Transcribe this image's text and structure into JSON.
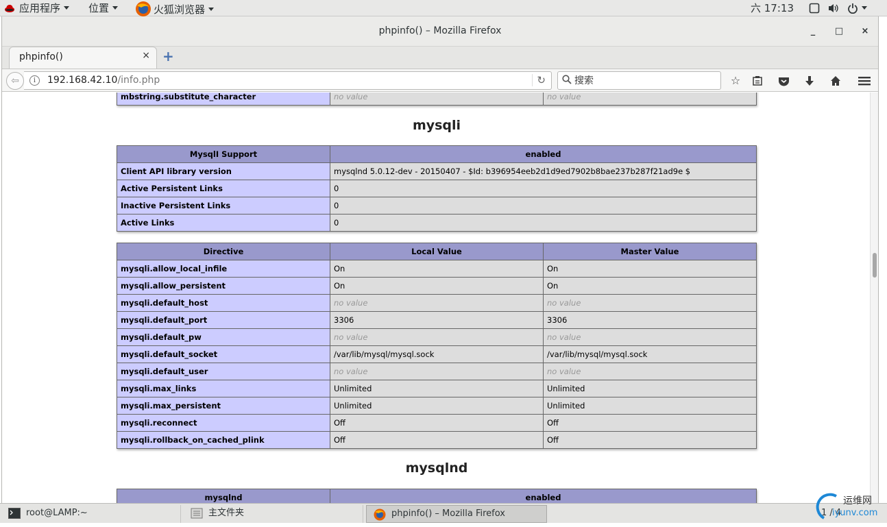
{
  "panel": {
    "apps_label": "应用程序",
    "places_label": "位置",
    "browser_label": "火狐浏览器",
    "clock": "六 17:13"
  },
  "window": {
    "title": "phpinfo() – Mozilla Firefox",
    "minimize": "_",
    "maximize": "□",
    "close": "×"
  },
  "tab": {
    "label": "phpinfo()",
    "close": "×",
    "new_tab": "+"
  },
  "nav": {
    "url_host": "192.168.42.10",
    "url_path": "/info.php",
    "search_placeholder": "搜索"
  },
  "content": {
    "top_row": {
      "key": "mbstring.substitute_character",
      "local": "no value",
      "master": "no value"
    },
    "mysqli_heading": "mysqli",
    "mysqli_support": {
      "header_key": "MysqlI Support",
      "header_value": "enabled",
      "rows": [
        {
          "key": "Client API library version",
          "value": "mysqlnd 5.0.12-dev - 20150407 - $Id: b396954eeb2d1d9ed7902b8bae237b287f21ad9e $"
        },
        {
          "key": "Active Persistent Links",
          "value": "0"
        },
        {
          "key": "Inactive Persistent Links",
          "value": "0"
        },
        {
          "key": "Active Links",
          "value": "0"
        }
      ]
    },
    "directives": {
      "headers": [
        "Directive",
        "Local Value",
        "Master Value"
      ],
      "rows": [
        {
          "key": "mysqli.allow_local_infile",
          "local": "On",
          "master": "On"
        },
        {
          "key": "mysqli.allow_persistent",
          "local": "On",
          "master": "On"
        },
        {
          "key": "mysqli.default_host",
          "local": "no value",
          "master": "no value"
        },
        {
          "key": "mysqli.default_port",
          "local": "3306",
          "master": "3306"
        },
        {
          "key": "mysqli.default_pw",
          "local": "no value",
          "master": "no value"
        },
        {
          "key": "mysqli.default_socket",
          "local": "/var/lib/mysql/mysql.sock",
          "master": "/var/lib/mysql/mysql.sock"
        },
        {
          "key": "mysqli.default_user",
          "local": "no value",
          "master": "no value"
        },
        {
          "key": "mysqli.max_links",
          "local": "Unlimited",
          "master": "Unlimited"
        },
        {
          "key": "mysqli.max_persistent",
          "local": "Unlimited",
          "master": "Unlimited"
        },
        {
          "key": "mysqli.reconnect",
          "local": "Off",
          "master": "Off"
        },
        {
          "key": "mysqli.rollback_on_cached_plink",
          "local": "Off",
          "master": "Off"
        }
      ]
    },
    "mysqlnd_heading": "mysqlnd",
    "mysqlnd_header": {
      "key": "mysqlnd",
      "value": "enabled"
    }
  },
  "taskbar": {
    "tasks": [
      {
        "label": "root@LAMP:~"
      },
      {
        "label": "主文件夹"
      },
      {
        "label": "phpinfo() – Mozilla Firefox"
      }
    ],
    "page_indicator": "1 / 4"
  },
  "watermark": {
    "line1": "运维网",
    "line2": "iyunv.com"
  },
  "colors": {
    "php_header": "#9999cc",
    "php_key": "#ccccff",
    "php_value": "#dddddd"
  }
}
